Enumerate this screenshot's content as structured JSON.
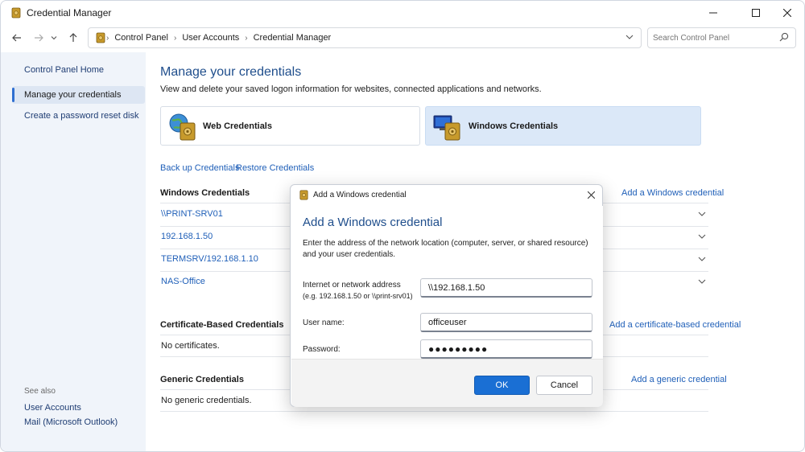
{
  "window": {
    "title": "Credential Manager"
  },
  "breadcrumbs": [
    "Control Panel",
    "User Accounts",
    "Credential Manager"
  ],
  "search": {
    "placeholder": "Search Control Panel"
  },
  "sidebar": {
    "home": "Control Panel Home",
    "items": [
      "Manage your credentials",
      "Create a password reset disk"
    ],
    "see_also_label": "See also",
    "see_also": [
      "User Accounts",
      "Mail (Microsoft Outlook)"
    ]
  },
  "main": {
    "title": "Manage your credentials",
    "description": "View and delete your saved logon information for websites, connected applications and networks.",
    "categories": [
      {
        "label": "Web Credentials",
        "icon": "globe-vault-icon"
      },
      {
        "label": "Windows Credentials",
        "icon": "computer-vault-icon"
      }
    ],
    "backup_link": "Back up Credentials",
    "restore_link": "Restore Credentials",
    "windows_section": {
      "heading": "Windows Credentials",
      "add_link": "Add a Windows credential",
      "items": [
        "\\\\PRINT-SRV01",
        "192.168.1.50",
        "TERMSRV/192.168.1.10",
        "NAS-Office"
      ]
    },
    "cert_section": {
      "heading": "Certificate-Based Credentials",
      "add_link": "Add a certificate-based credential",
      "empty": "No certificates."
    },
    "generic_section": {
      "heading": "Generic Credentials",
      "add_link": "Add a generic credential",
      "empty": "No generic credentials."
    }
  },
  "dialog": {
    "title": "Add a Windows credential",
    "heading": "Add a Windows credential",
    "description": "Enter the address of the network location (computer, server, or shared resource) and your user credentials.",
    "address_label": "Internet or network address",
    "address_hint": "(e.g. 192.168.1.50 or \\\\print-srv01)",
    "address_value": "\\\\192.168.1.50",
    "username_label": "User name:",
    "username_value": "officeuser",
    "password_label": "Password:",
    "password_value": "●●●●●●●●●",
    "ok_label": "OK",
    "cancel_label": "Cancel"
  },
  "colors": {
    "accent": "#1a6fd4",
    "link": "#1f5fb8",
    "heading": "#1f4e8c",
    "sidebar_bg": "#f0f4fa"
  }
}
